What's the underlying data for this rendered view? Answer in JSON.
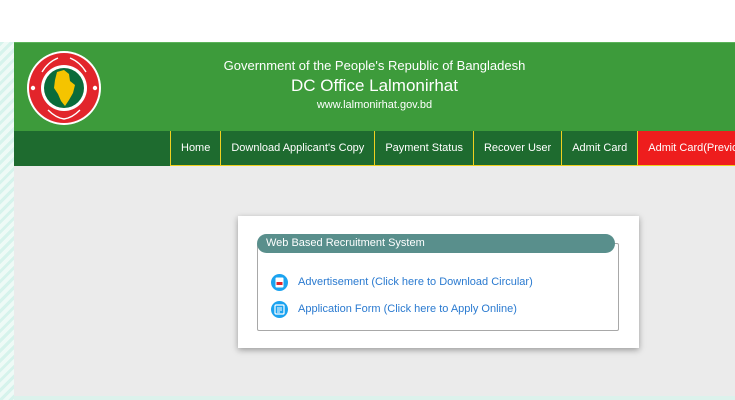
{
  "header": {
    "line1": "Government of the People's Republic of Bangladesh",
    "line2": "DC Office Lalmonirhat",
    "line3": "www.lalmonirhat.gov.bd"
  },
  "nav": {
    "items": [
      {
        "label": "Home"
      },
      {
        "label": "Download Applicant's Copy"
      },
      {
        "label": "Payment Status"
      },
      {
        "label": "Recover User"
      },
      {
        "label": "Admit Card"
      },
      {
        "label": "Admit Card(Previous)"
      }
    ]
  },
  "panel": {
    "title": "Web Based Recruitment System",
    "links": [
      {
        "label": "Advertisement (Click here to Download Circular)",
        "icon": "pdf-icon"
      },
      {
        "label": "Application Form (Click here to Apply Online)",
        "icon": "form-icon"
      }
    ]
  },
  "colors": {
    "header_green": "#3d9b3b",
    "nav_green": "#1e6b2f",
    "highlight_red": "#ee1d1d",
    "nav_border": "#f0d020",
    "legend_teal": "#598f8c",
    "link_blue": "#2a7ad0"
  }
}
